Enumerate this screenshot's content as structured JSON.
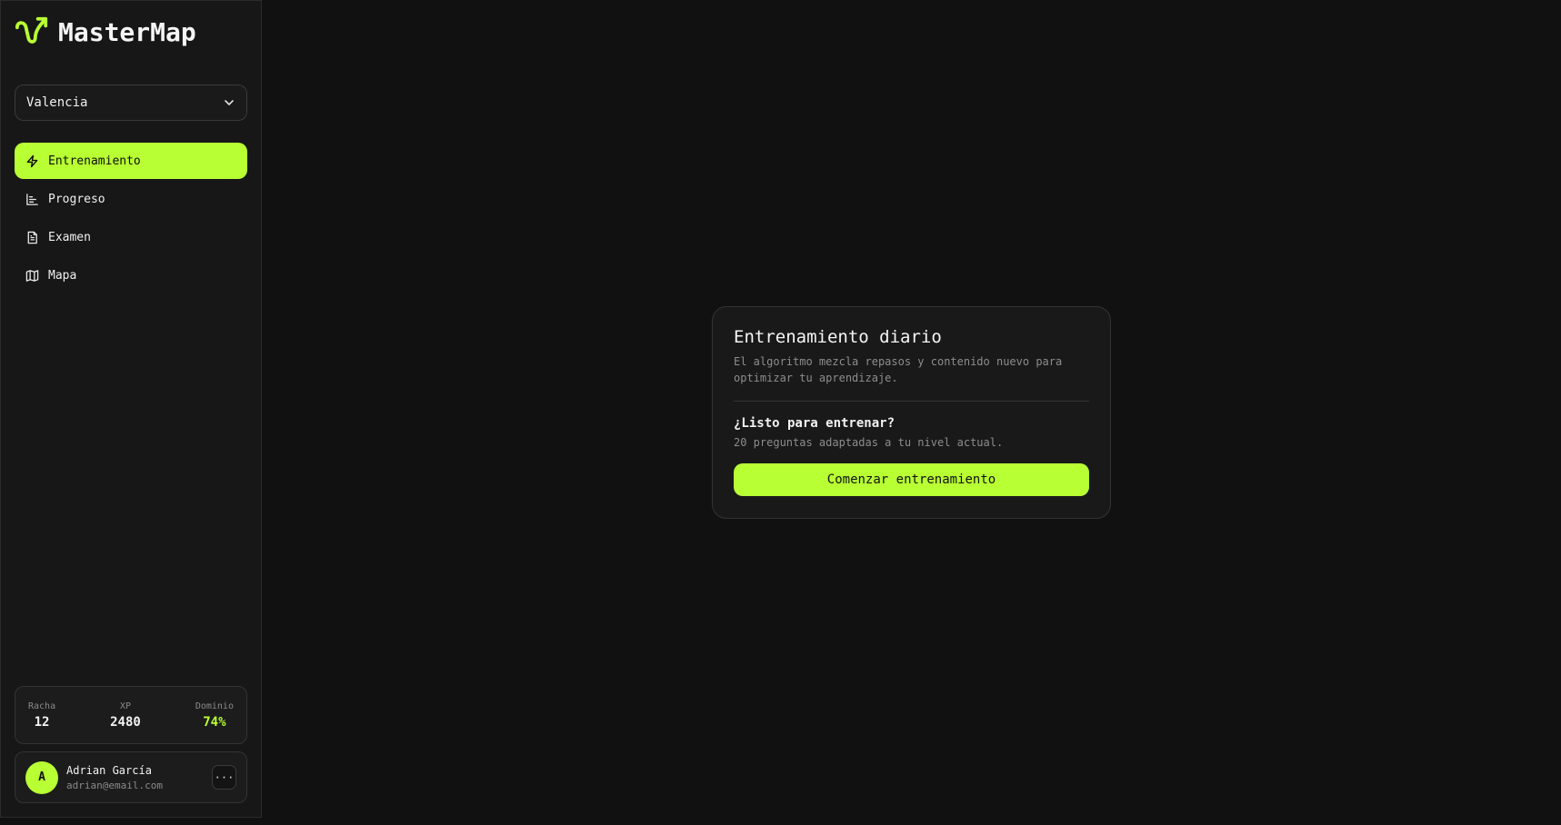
{
  "app": {
    "name": "MasterMap"
  },
  "location_select": {
    "value": "Valencia"
  },
  "nav": {
    "items": [
      {
        "label": "Entrenamiento"
      },
      {
        "label": "Progreso"
      },
      {
        "label": "Examen"
      },
      {
        "label": "Mapa"
      }
    ]
  },
  "stats": {
    "streak_label": "Racha",
    "streak_value": "12",
    "xp_label": "XP",
    "xp_value": "2480",
    "mastery_label": "Dominio",
    "mastery_value": "74%"
  },
  "user": {
    "initial": "A",
    "name": "Adrian García",
    "email": "adrian@email.com",
    "more_label": "···"
  },
  "card": {
    "title": "Entrenamiento diario",
    "description": "El algoritmo mezcla repasos y contenido nuevo para optimizar tu aprendizaje.",
    "ready_title": "¿Listo para entrenar?",
    "ready_subtitle": "20 preguntas adaptadas a tu nivel actual.",
    "start_button": "Comenzar entrenamiento"
  },
  "colors": {
    "accent": "#b8ff33",
    "background": "#111111",
    "sidebar": "#171717"
  }
}
